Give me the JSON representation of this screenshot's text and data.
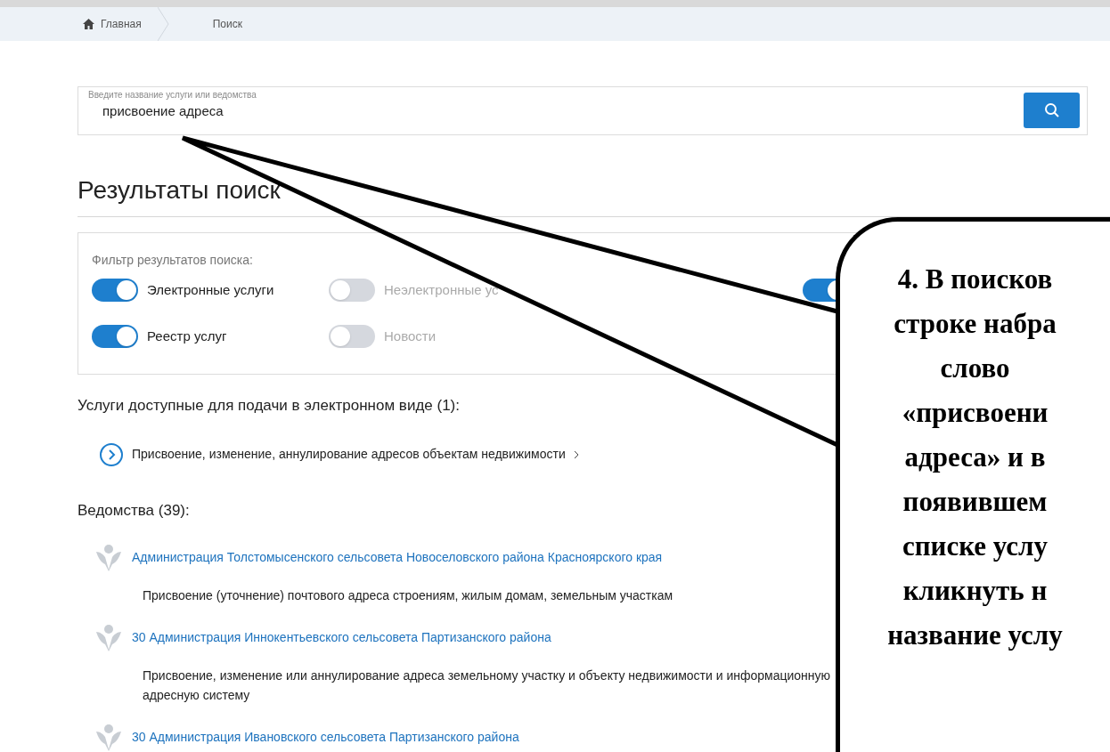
{
  "breadcrumbs": [
    {
      "label": "Главная",
      "kind": "home"
    },
    {
      "label": "Поиск",
      "kind": "page"
    }
  ],
  "search": {
    "placeholder": "Введите название услуги или ведомства",
    "value": "присвоение адреса"
  },
  "heading": "Результаты поиск",
  "filter": {
    "title": "Фильтр результатов поиска:",
    "toggles": [
      {
        "label": "Электронные услуги",
        "on": true
      },
      {
        "label": "Неэлектронные ус",
        "on": false
      },
      {
        "on": true
      },
      {
        "label": "Реестр услуг",
        "on": true
      },
      {
        "label": "Новости",
        "on": false
      }
    ]
  },
  "services": {
    "title": "Услуги доступные для подачи в электронном виде (1):",
    "items": [
      "Присвоение, изменение, аннулирование адресов объектам недвижимости"
    ]
  },
  "agencies": {
    "title": "Ведомства (39):",
    "items": [
      {
        "name": "Администрация Толстомысенского сельсовета Новоселовского района Красноярского края",
        "service": "Присвоение (уточнение) почтового адреса строениям, жилым домам, земельным участкам"
      },
      {
        "name": "30 Администрация Иннокентьевского сельсовета Партизанского района",
        "service": "Присвоение, изменение или аннулирование адреса земельному участку и объекту недвижимости и информационную адресную систему"
      },
      {
        "name": "30 Администрация Ивановского сельсовета Партизанского района"
      }
    ]
  },
  "callout": {
    "lines": [
      "4. В поисков",
      "строке набра",
      "слово",
      "«присвоени",
      "адреса» и в",
      "появившем",
      "списке услу",
      "кликнуть н",
      "название услу"
    ]
  }
}
